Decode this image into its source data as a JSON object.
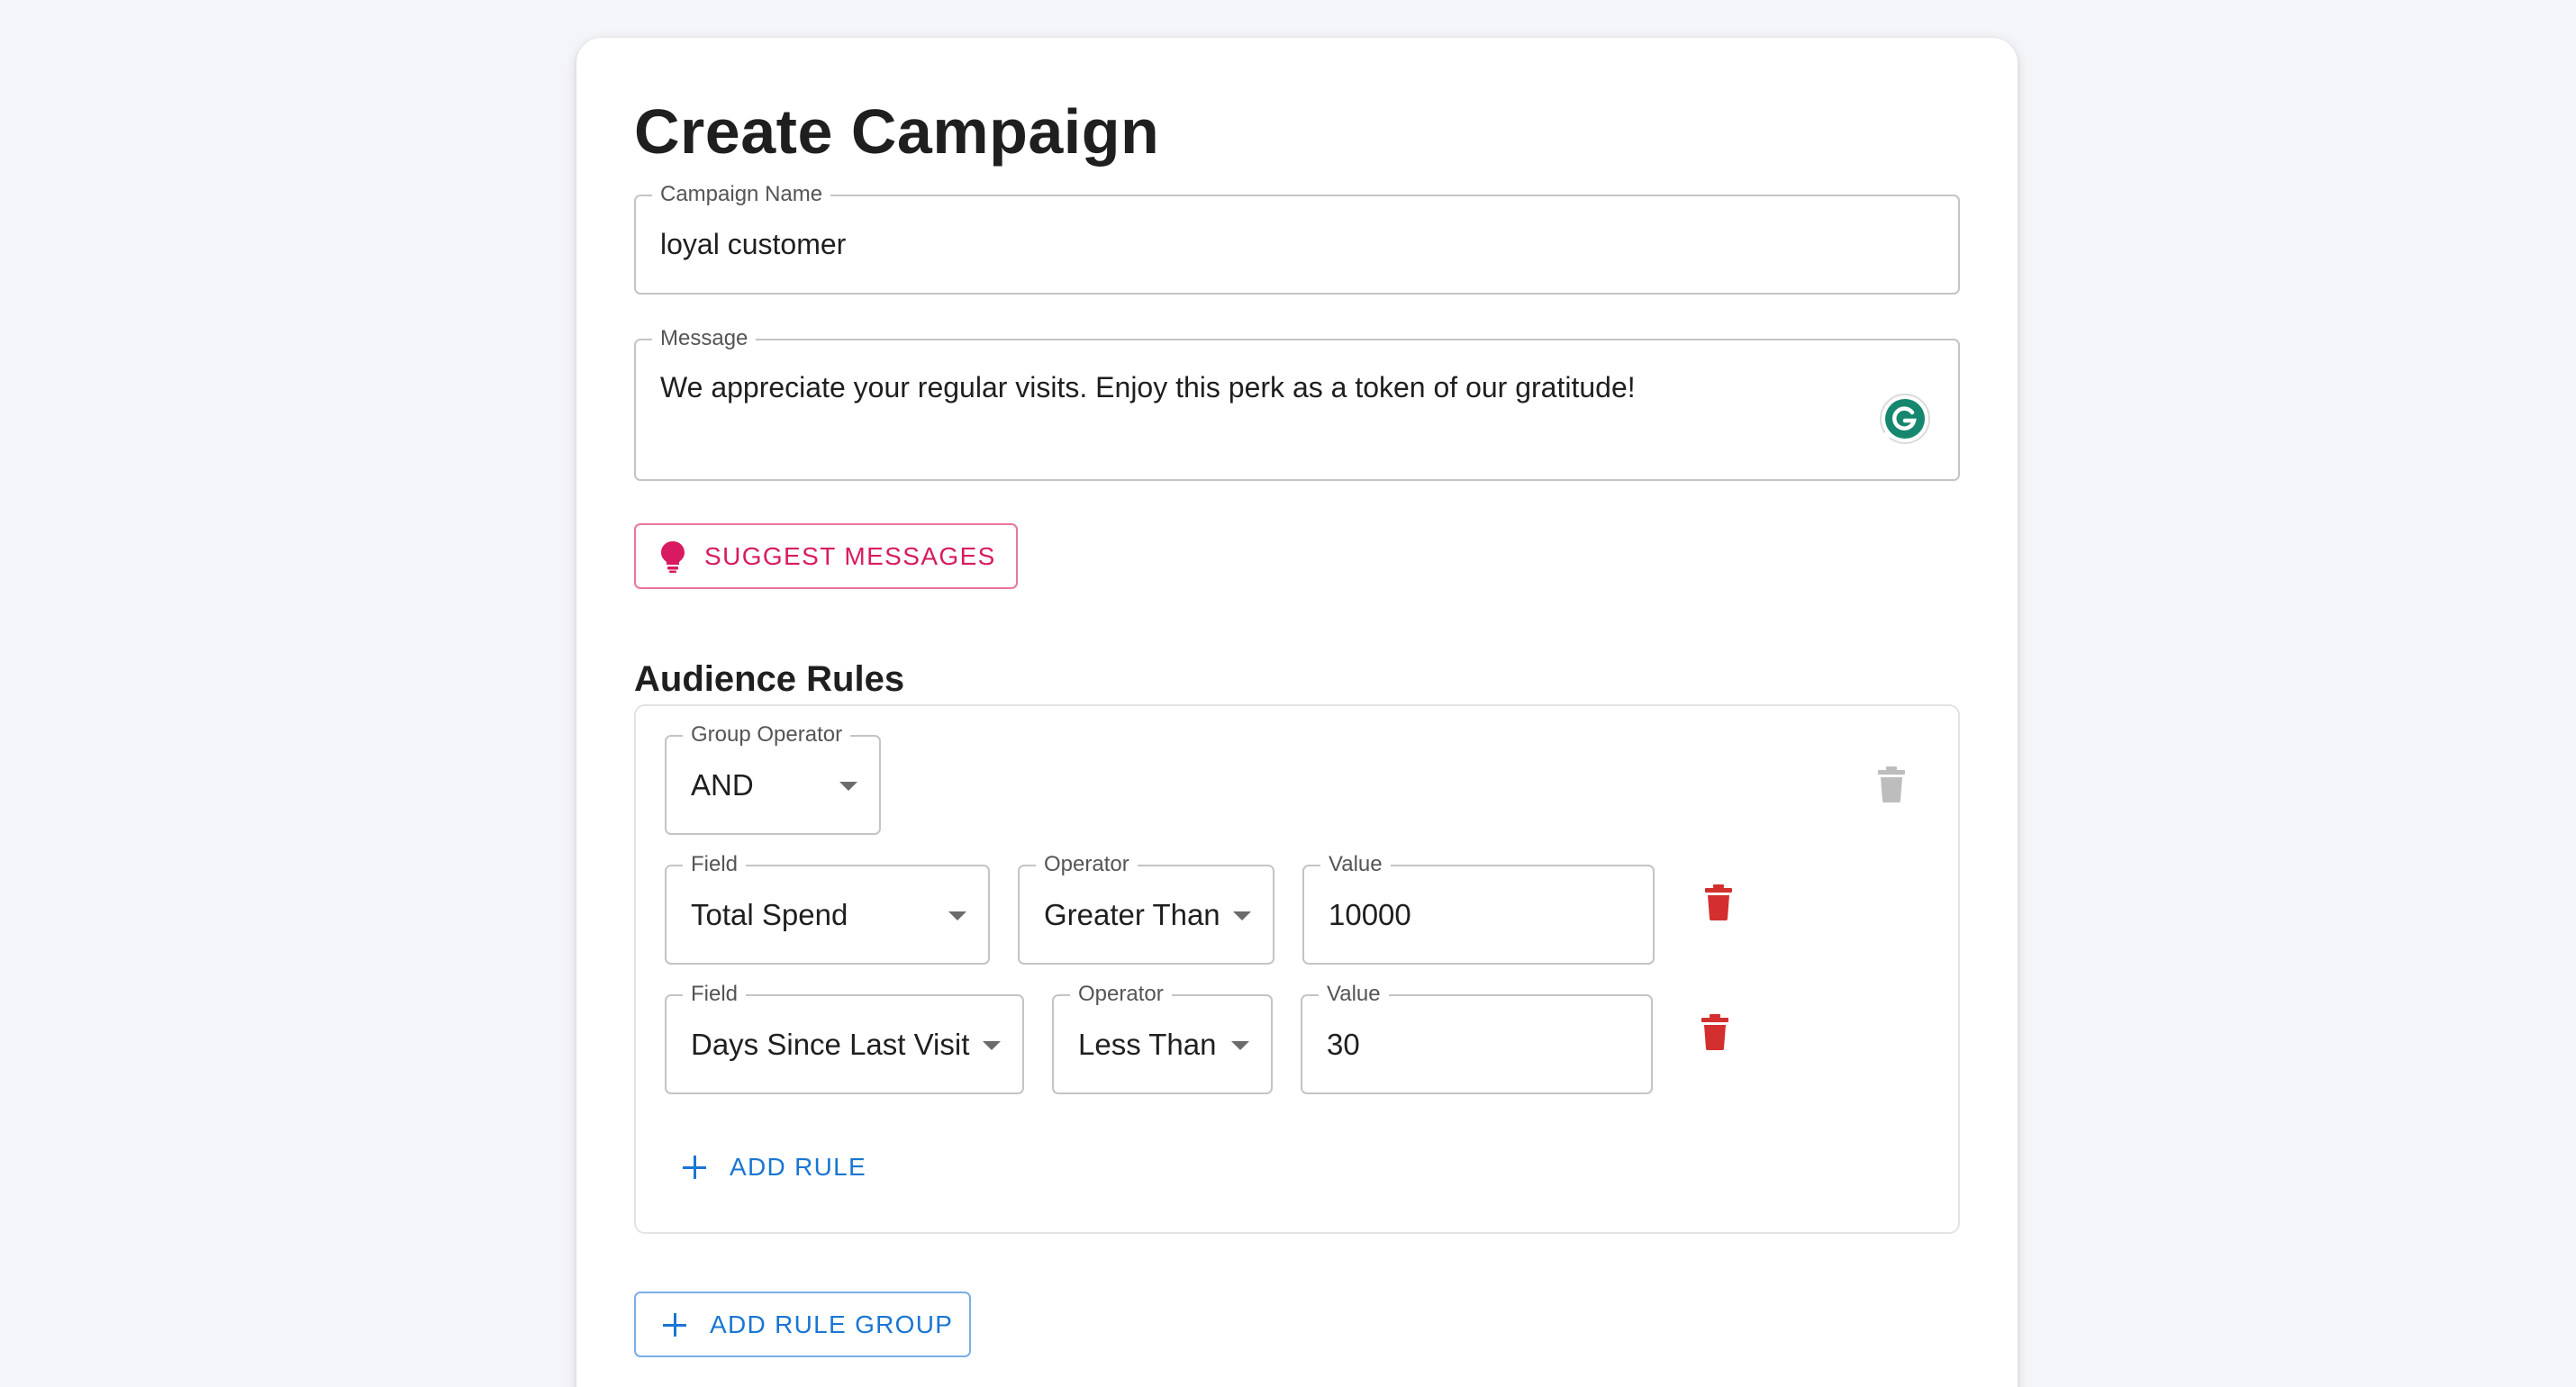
{
  "page": {
    "title": "Create Campaign"
  },
  "campaign_name": {
    "label": "Campaign Name",
    "value": "loyal customer"
  },
  "message": {
    "label": "Message",
    "value": "We appreciate your regular visits. Enjoy this perk as a token of our gratitude!",
    "extension_icon": "grammarly-icon"
  },
  "suggest_button": {
    "label": "SUGGEST MESSAGES",
    "icon": "lightbulb-icon"
  },
  "audience": {
    "title": "Audience Rules",
    "groups": [
      {
        "operator_label": "Group Operator",
        "operator_value": "AND",
        "rules": [
          {
            "field_label": "Field",
            "field_value": "Total Spend",
            "operator_label": "Operator",
            "operator_value": "Greater Than",
            "value_label": "Value",
            "value": "10000"
          },
          {
            "field_label": "Field",
            "field_value": "Days Since Last Visit",
            "operator_label": "Operator",
            "operator_value": "Less Than",
            "value_label": "Value",
            "value": "30"
          }
        ],
        "add_rule_label": "ADD RULE"
      }
    ],
    "add_group_label": "ADD RULE GROUP"
  },
  "colors": {
    "accent_blue": "#1976d2",
    "accent_pink": "#d81b60",
    "delete_red": "#d32f2f",
    "disabled_gray": "#bdbdbd",
    "grammarly_green": "#15876e",
    "page_background": "#f4f5f8"
  }
}
